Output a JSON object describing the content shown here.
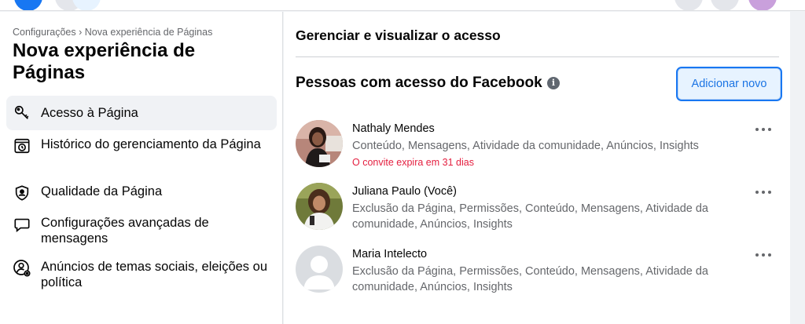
{
  "sidebar": {
    "breadcrumb": "Configurações › Nova experiência de Páginas",
    "title": "Nova experiência de Páginas",
    "items": [
      {
        "label": "Acesso à Página",
        "icon": "key-icon",
        "active": true
      },
      {
        "label": "Histórico do gerenciamento da Página",
        "icon": "history-icon",
        "active": false
      },
      {
        "label": "Qualidade da Página",
        "icon": "shield-icon",
        "active": false
      },
      {
        "label": "Configurações avançadas de mensagens",
        "icon": "message-bubble-icon",
        "active": false
      },
      {
        "label": "Anúncios de temas sociais, eleições ou política",
        "icon": "person-gear-icon",
        "active": false
      }
    ]
  },
  "main": {
    "section_title": "Gerenciar e visualizar o acesso",
    "people_title": "Pessoas com acesso do Facebook",
    "info_glyph": "i",
    "add_button": "Adicionar novo",
    "people": [
      {
        "name": "Nathaly Mendes",
        "permissions": "Conteúdo, Mensagens, Atividade da comunidade, Anúncios, Insights",
        "invite": "O convite expira em 31 dias"
      },
      {
        "name": "Juliana Paulo (Você)",
        "permissions": "Exclusão da Página, Permissões, Conteúdo, Mensagens, Atividade da comunidade, Anúncios, Insights",
        "invite": ""
      },
      {
        "name": "Maria Intelecto",
        "permissions": "Exclusão da Página, Permissões, Conteúdo, Mensagens, Atividade da comunidade, Anúncios, Insights",
        "invite": ""
      }
    ]
  },
  "colors": {
    "accent": "#1877f2",
    "invite_red": "#e41e3f",
    "secondary_text": "#65676b"
  }
}
